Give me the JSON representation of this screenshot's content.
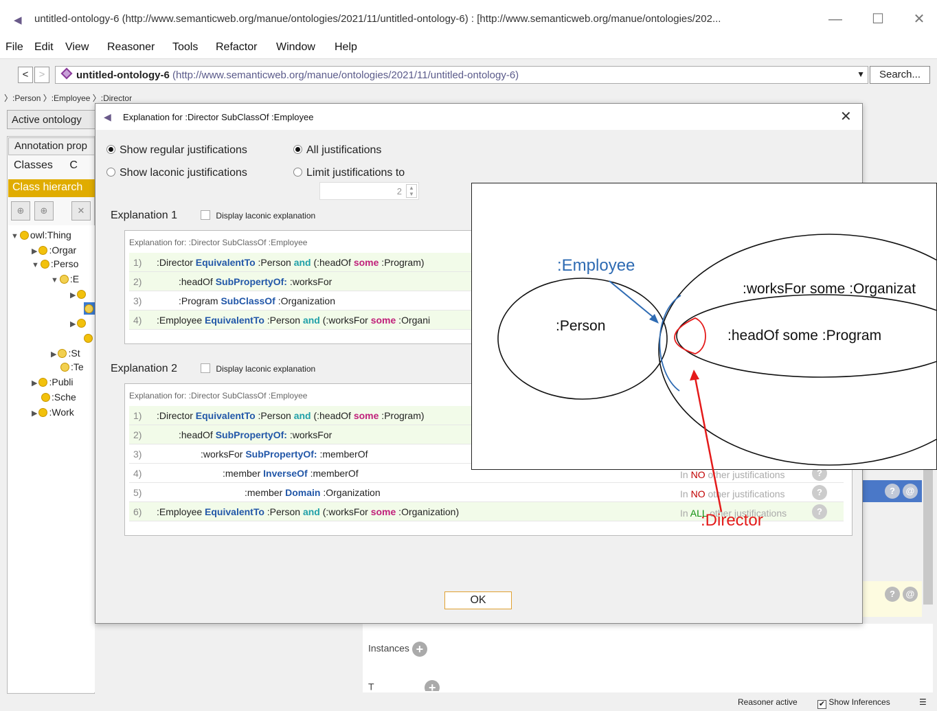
{
  "window": {
    "title": "untitled-ontology-6 (http://www.semanticweb.org/manue/ontologies/2021/11/untitled-ontology-6) : [http://www.semanticweb.org/manue/ontologies/202...",
    "minimize": "—",
    "maximize": "☐",
    "close": "✕"
  },
  "menu": [
    "File",
    "Edit",
    "View",
    "Reasoner",
    "Tools",
    "Refactor",
    "Window",
    "Help"
  ],
  "address": {
    "back": "<",
    "forward": ">",
    "name": "untitled-ontology-6",
    "iri": "(http://www.semanticweb.org/manue/ontologies/2021/11/untitled-ontology-6)",
    "search": "Search..."
  },
  "breadcrumb": {
    "items": [
      ":Person",
      ":Employee",
      ":Director"
    ]
  },
  "main": {
    "active_tab": "Active ontology",
    "annotation_tab": "Annotation prop",
    "classes_tab": "Classes",
    "classes_tab2": "C",
    "class_hierarchy": "Class hierarch",
    "tree": [
      {
        "label": "owl:Thing"
      },
      {
        "label": ":Orgar"
      },
      {
        "label": ":Perso"
      },
      {
        "label": ":E"
      },
      {
        "label": ":St"
      },
      {
        "label": ":Te"
      },
      {
        "label": ":Publi"
      },
      {
        "label": ":Sche"
      },
      {
        "label": ":Work"
      }
    ],
    "instances": "Instances",
    "types_partial": "T"
  },
  "status": {
    "reasoner": "Reasoner active",
    "show_inferences": "Show Inferences"
  },
  "dialog": {
    "title": "Explanation for :Director SubClassOf :Employee",
    "close": "✕",
    "opt_regular": "Show regular justifications",
    "opt_laconic": "Show laconic justifications",
    "opt_all": "All justifications",
    "opt_limit": "Limit justifications to",
    "limit_value": "2",
    "ok": "OK",
    "explanations": [
      {
        "heading": "Explanation 1",
        "laconic": "Display laconic explanation",
        "for": "Explanation for: :Director SubClassOf :Employee",
        "axioms": [
          {
            "num": "1)",
            "parts": [
              ":Director ",
              "EquivalentTo",
              " :Person ",
              "and",
              " (:headOf ",
              "some",
              " :Program)"
            ]
          },
          {
            "num": "2)",
            "parts": [
              ":headOf ",
              "SubPropertyOf:",
              " :worksFor"
            ]
          },
          {
            "num": "3)",
            "parts": [
              ":Program ",
              "SubClassOf",
              " :Organization"
            ]
          },
          {
            "num": "4)",
            "parts": [
              ":Employee ",
              "EquivalentTo",
              " :Person ",
              "and",
              " (:worksFor ",
              "some",
              " :Organi"
            ]
          }
        ]
      },
      {
        "heading": "Explanation 2",
        "laconic": "Display laconic explanation",
        "for": "Explanation for: :Director SubClassOf :Employee",
        "axioms": [
          {
            "num": "1)",
            "parts": [
              ":Director ",
              "EquivalentTo",
              " :Person ",
              "and",
              " (:headOf ",
              "some",
              " :Program)"
            ]
          },
          {
            "num": "2)",
            "parts": [
              ":headOf ",
              "SubPropertyOf:",
              " :worksFor"
            ]
          },
          {
            "num": "3)",
            "parts": [
              ":worksFor ",
              "SubPropertyOf:",
              " :memberOf"
            ]
          },
          {
            "num": "4)",
            "parts": [
              ":member ",
              "InverseOf",
              " :memberOf"
            ],
            "other_pre": "In ",
            "other_kw": "NO",
            "other_post": " other justifications"
          },
          {
            "num": "5)",
            "parts": [
              ":member ",
              "Domain",
              " :Organization"
            ],
            "other_pre": "In ",
            "other_kw": "NO",
            "other_post": " other justifications"
          },
          {
            "num": "6)",
            "parts": [
              ":Employee ",
              "EquivalentTo",
              " :Person ",
              "and",
              " (:worksFor ",
              "some",
              " :Organization)"
            ],
            "other_pre": "In ",
            "other_kw": "ALL",
            "other_post": " other justifications"
          }
        ]
      }
    ]
  },
  "diagram": {
    "employee": ":Employee",
    "person": ":Person",
    "works_for": ":worksFor some :Organizat",
    "head_of": ":headOf some :Program",
    "director": ":Director",
    "colors": {
      "employee": "#2e6bb3",
      "director": "#e41a1a"
    }
  }
}
